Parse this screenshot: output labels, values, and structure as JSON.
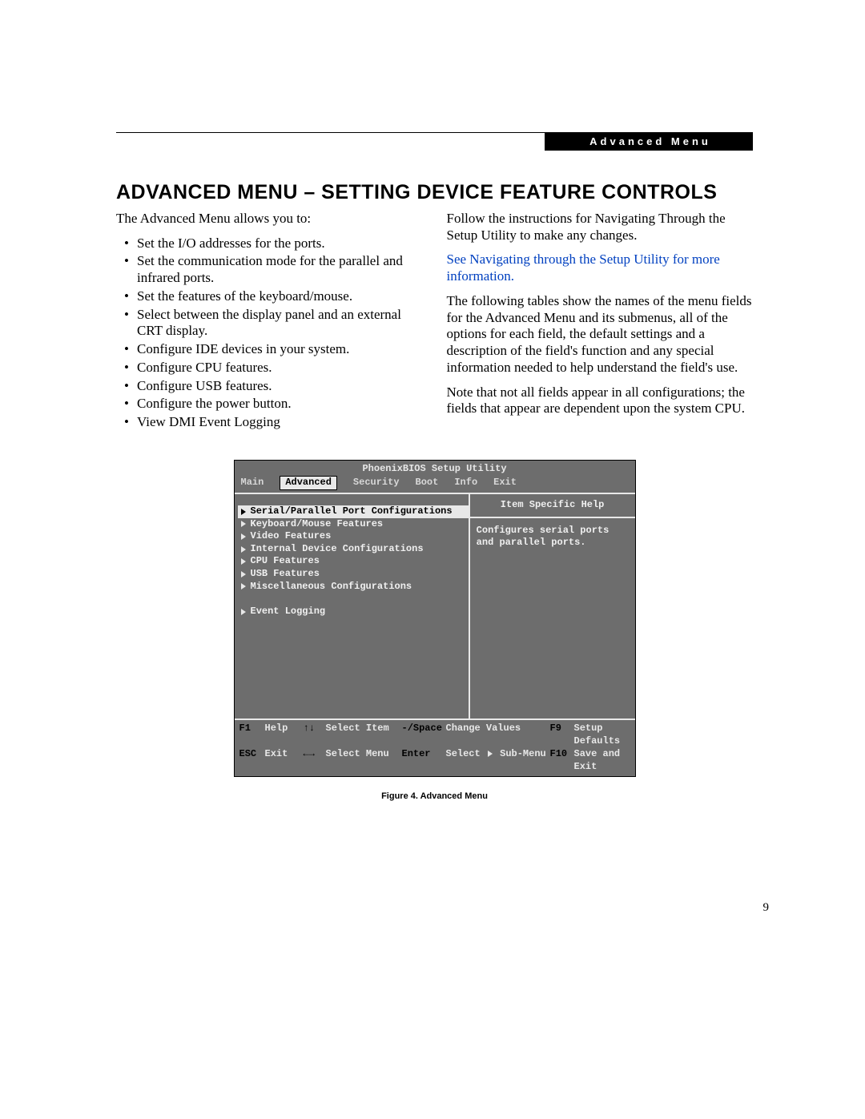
{
  "header": {
    "section_tag": "Advanced Menu",
    "title": "ADVANCED MENU – SETTING DEVICE FEATURE CONTROLS"
  },
  "left_col": {
    "intro": "The Advanced Menu allows you to:",
    "bullets": [
      "Set the I/O addresses for the ports.",
      "Set the communication mode for the parallel and infrared ports.",
      "Set the features of the keyboard/mouse.",
      "Select between the display panel and an external CRT display.",
      "Configure IDE devices in your system.",
      "Configure CPU features.",
      "Configure USB features.",
      "Configure the power button.",
      "View DMI Event Logging"
    ]
  },
  "right_col": {
    "p1": "Follow the instructions for Navigating Through the Setup Utility to make any changes.",
    "link": "See Navigating through the Setup Utility for more information.",
    "p2": "The following tables show the names of the menu fields for the Advanced Menu and its submenus, all of the options for each field, the default settings and a description of the field's function and any special information needed to help understand the field's use.",
    "p3": "Note that not all fields appear in all configurations; the fields that appear are dependent upon the system CPU."
  },
  "bios": {
    "title": "PhoenixBIOS Setup Utility",
    "tabs": [
      "Main",
      "Advanced",
      "Security",
      "Boot",
      "Info",
      "Exit"
    ],
    "active_tab": "Advanced",
    "items": [
      "Serial/Parallel Port Configurations",
      "Keyboard/Mouse Features",
      "Video Features",
      "Internal Device Configurations",
      "CPU Features",
      "USB Features",
      "Miscellaneous Configurations"
    ],
    "items2": [
      "Event Logging"
    ],
    "help_title": "Item Specific Help",
    "help_body": "Configures serial ports and parallel ports.",
    "footer": {
      "f1": "F1",
      "help": "Help",
      "updown": "↑↓",
      "select_item": "Select Item",
      "minus_space": "-/Space",
      "change_values": "Change Values",
      "f9": "F9",
      "setup_defaults": "Setup Defaults",
      "esc": "ESC",
      "exit": "Exit",
      "leftright": "←→",
      "select_menu": "Select Menu",
      "enter": "Enter",
      "select_submenu": "Select ▶ Sub-Menu",
      "f10": "F10",
      "save_exit": "Save and Exit"
    }
  },
  "caption": "Figure 4.  Advanced Menu",
  "page_number": "9"
}
